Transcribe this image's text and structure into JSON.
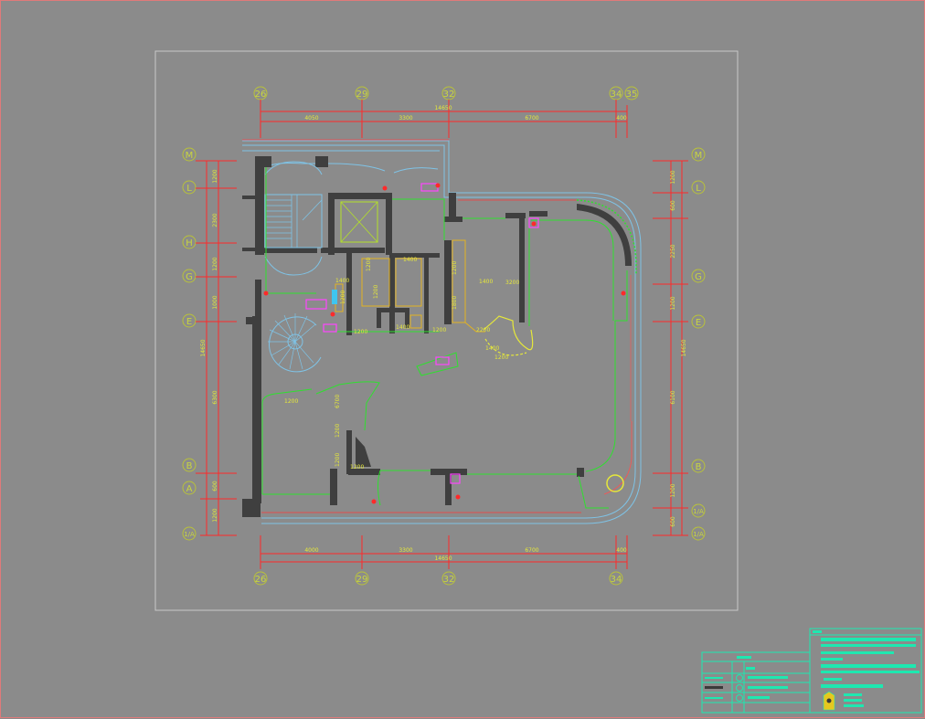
{
  "axes": {
    "top": [
      "26",
      "29",
      "32",
      "34",
      "35"
    ],
    "bottom": [
      "26",
      "29",
      "32",
      "34"
    ],
    "left": [
      "M",
      "L",
      "H",
      "G",
      "E",
      "B",
      "A",
      "1/A"
    ],
    "right": [
      "M",
      "L",
      "G",
      "E",
      "B",
      "1/A",
      "1/A"
    ]
  },
  "dimensions": {
    "top_total": "14650",
    "top_segments": [
      "4050",
      "3300",
      "6700",
      "400"
    ],
    "bottom_total": "14650",
    "bottom_segments": [
      "4000",
      "3300",
      "6700",
      "400"
    ],
    "left_total": "14650",
    "left_segments": [
      "1200",
      "2300",
      "1200",
      "1000",
      "6300",
      "600",
      "1200"
    ],
    "right_total": "14650",
    "right_segments": [
      "1200",
      "600",
      "2250",
      "1200",
      "6100",
      "1200",
      "600"
    ]
  },
  "interior_labels": [
    "1400",
    "1200",
    "1400",
    "1200",
    "1200",
    "1200",
    "1400",
    "1200",
    "2200",
    "1200",
    "6700",
    "1200",
    "1200",
    "1200",
    "1400",
    "3200",
    "1200",
    "1400",
    "1200",
    "1800"
  ],
  "colors": {
    "background": "#8b8b8b",
    "wall": "#3f3f3f",
    "dimension": "#ff2a2a",
    "dimension_text": "#e6e83a",
    "axis": "#b9c23a",
    "cyan": "#7fc3e6",
    "green": "#2fe02f",
    "yellow": "#e3b321",
    "magenta": "#ff45ff",
    "titleblock": "#1ee8b0"
  }
}
